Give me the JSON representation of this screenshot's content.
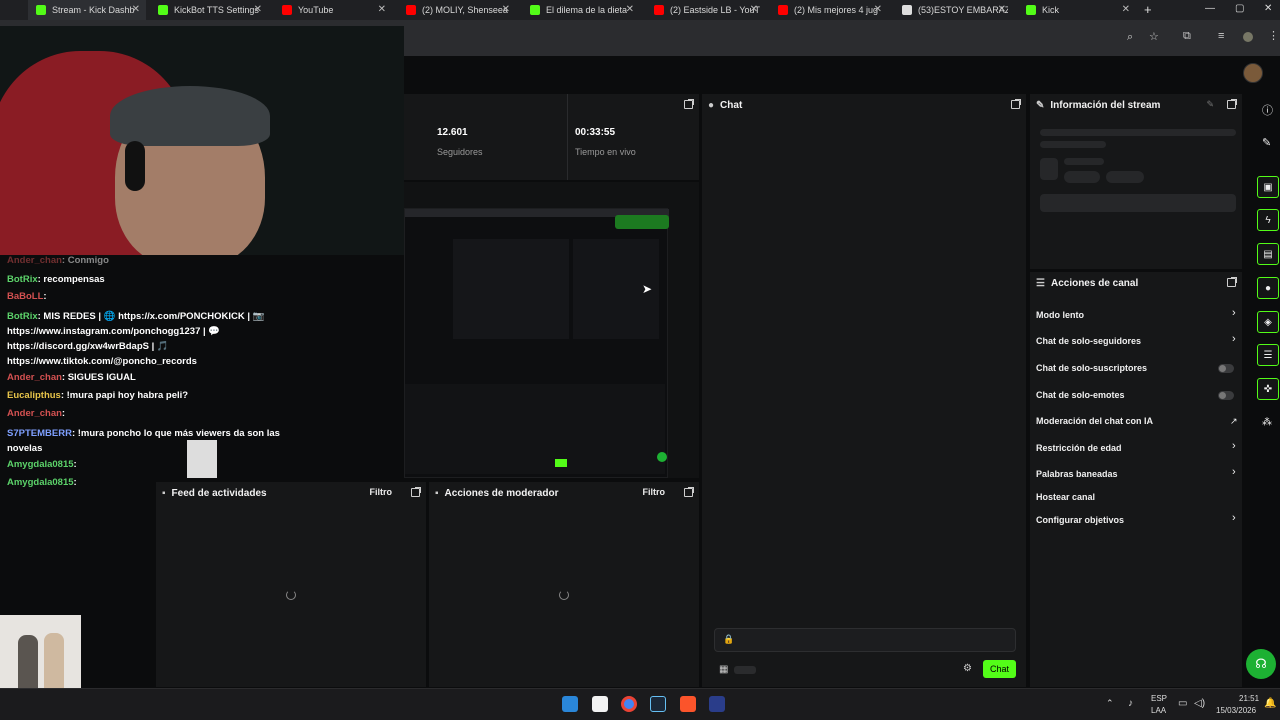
{
  "browser": {
    "tabs": [
      {
        "label": "Stream - Kick Dashb",
        "color": "#53fc18"
      },
      {
        "label": "KickBot TTS Settings",
        "color": "#53fc18"
      },
      {
        "label": "YouTube",
        "color": "#ff0000"
      },
      {
        "label": "(2) MOLIY, Shenseea",
        "color": "#ff0000"
      },
      {
        "label": "El dilema de la dieta",
        "color": "#53fc18"
      },
      {
        "label": "(2) Eastside LB - YouT",
        "color": "#ff0000"
      },
      {
        "label": "(2) Mis mejores 4 jug",
        "color": "#ff0000"
      },
      {
        "label": "(53)ESTOY EMBARAZ",
        "color": "#dddddd"
      },
      {
        "label": "Kick",
        "color": "#53fc18"
      }
    ],
    "new_tab": "+",
    "window_controls": {
      "minimize": "—",
      "maximize": "▢",
      "close": "✕"
    }
  },
  "stats": {
    "followers_value": "12.601",
    "followers_label": "Seguidores",
    "live_time_value": "00:33:55",
    "live_time_label": "Tiempo en vivo"
  },
  "chat_panel": {
    "title": "Chat",
    "send_label": "Chat"
  },
  "stream_info": {
    "title": "Información del stream"
  },
  "channel_actions": {
    "title": "Acciones de canal",
    "items": [
      {
        "label": "Modo lento",
        "control": "chevron"
      },
      {
        "label": "Chat de solo-seguidores",
        "control": "chevron"
      },
      {
        "label": "Chat de solo-suscriptores",
        "control": "toggle"
      },
      {
        "label": "Chat de solo-emotes",
        "control": "toggle"
      },
      {
        "label": "Moderación del chat con IA",
        "control": "external"
      },
      {
        "label": "Restricción de edad",
        "control": "chevron"
      },
      {
        "label": "Palabras baneadas",
        "control": "chevron"
      },
      {
        "label": "Hostear canal",
        "control": "none"
      },
      {
        "label": "Configurar objetivos",
        "control": "chevron"
      }
    ]
  },
  "activity_feed": {
    "title": "Feed de actividades",
    "filter": "Filtro"
  },
  "mod_actions": {
    "title": "Acciones de moderador",
    "filter": "Filtro"
  },
  "overlay_chat": {
    "lines": [
      {
        "user": "Ander_chan",
        "text": ": Conmigo"
      },
      {
        "user": "BotRix",
        "text": ": recompensas"
      },
      {
        "user": "BaBoLL",
        "text": ":"
      },
      {
        "user": "BotRix",
        "text": ": MIS REDES | 🌐 https://x.com/PONCHOKICK | 📷 https://www.instagram.com/ponchogg1237 | 💬 https://discord.gg/xw4wrBdapS | 🎵 https://www.tiktok.com/@poncho_records"
      },
      {
        "user": "Ander_chan",
        "text": ": SIGUES IGUAL"
      },
      {
        "user": "Eucalipthus",
        "text": ": !mura papi hoy habra peli?"
      },
      {
        "user": "Ander_chan",
        "text": ":"
      },
      {
        "user": "S7PTEMBERR",
        "text": ": !mura poncho lo que más viewers da son las novelas"
      },
      {
        "user": "Amygdala0815",
        "text": ":"
      },
      {
        "user": "Amygdala0815",
        "text": ":"
      }
    ]
  },
  "taskbar": {
    "lang": "ESP",
    "lang2": "LAA",
    "time": "21:51",
    "date": "15/03/2026"
  }
}
